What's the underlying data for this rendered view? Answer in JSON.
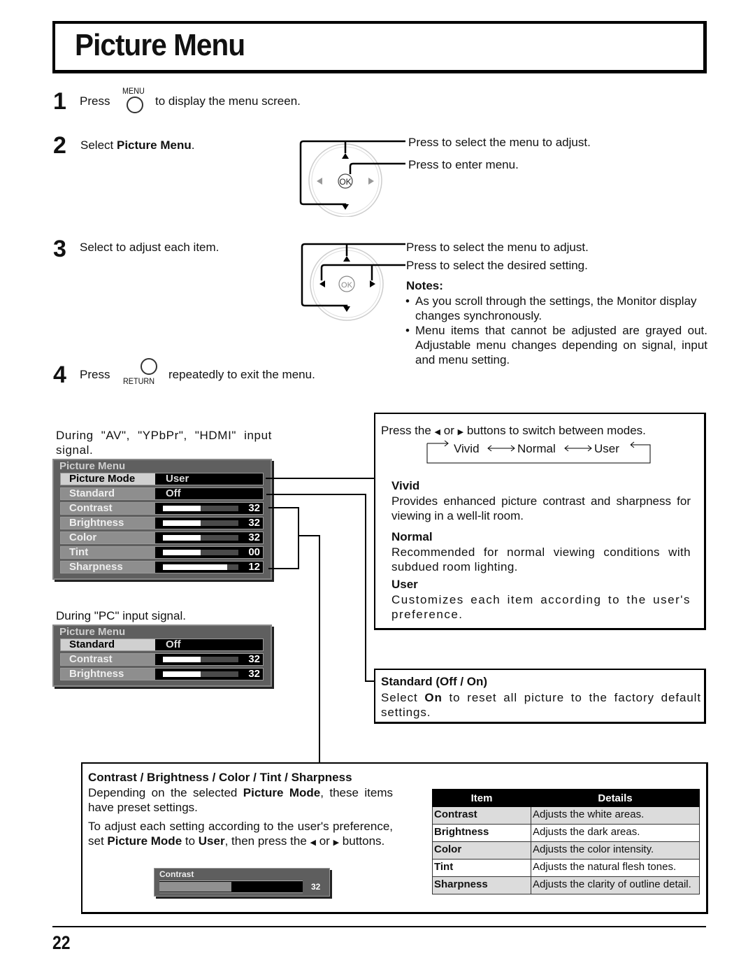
{
  "page": {
    "title": "Picture Menu",
    "page_number": "22"
  },
  "steps": [
    {
      "number": "1",
      "pre": "Press",
      "button_label": "MENU",
      "post": "to display the menu screen."
    },
    {
      "number": "2",
      "pre": "Select ",
      "bold": "Picture Menu",
      "post": "."
    },
    {
      "number": "3",
      "text": "Select to adjust each item."
    },
    {
      "number": "4",
      "pre": "Press",
      "button_label": "RETURN",
      "post": "repeatedly to exit the menu."
    }
  ],
  "remote_1": {
    "ok_label": "OK",
    "callouts": [
      "Press to select the menu to adjust.",
      "Press to enter menu."
    ]
  },
  "remote_2": {
    "ok_label": "OK",
    "callouts": [
      "Press to select the menu to adjust.",
      "Press to select the desired setting."
    ],
    "notes_heading": "Notes:",
    "notes": [
      "As you scroll through the settings, the Monitor display changes synchronously.",
      "Menu items that cannot be adjusted are grayed out. Adjustable menu changes depending on signal, input and menu setting."
    ]
  },
  "osd_av": {
    "caption": "During \"AV\", \"YPbPr\", \"HDMI\" input signal.",
    "title": "Picture Menu",
    "rows": [
      {
        "label": "Picture Mode",
        "value": "User",
        "selected": true
      },
      {
        "label": "Standard",
        "value": "Off"
      },
      {
        "label": "Contrast",
        "num": "32",
        "level": 0.5
      },
      {
        "label": "Brightness",
        "num": "32",
        "level": 0.5
      },
      {
        "label": "Color",
        "num": "32",
        "level": 0.5
      },
      {
        "label": "Tint",
        "num": "00",
        "level": 0.5
      },
      {
        "label": "Sharpness",
        "num": "12",
        "level": 0.85
      }
    ]
  },
  "osd_pc": {
    "caption": "During \"PC\" input signal.",
    "title": "Picture Menu",
    "rows": [
      {
        "label": "Standard",
        "value": "Off",
        "selected": true
      },
      {
        "label": "Contrast",
        "num": "32",
        "level": 0.5
      },
      {
        "label": "Brightness",
        "num": "32",
        "level": 0.5
      }
    ]
  },
  "modes_box": {
    "intro_pre": "Press the",
    "intro_mid": "or",
    "intro_post": "buttons to switch between modes.",
    "cycle": [
      "Vivid",
      "Normal",
      "User"
    ],
    "modes": [
      {
        "name": "Vivid",
        "desc": "Provides enhanced picture contrast and sharpness for viewing in a well-lit room."
      },
      {
        "name": "Normal",
        "desc": "Recommended for normal viewing conditions with subdued room lighting."
      },
      {
        "name": "User",
        "desc": "Customizes each item according to the user's preference."
      }
    ]
  },
  "standard_box": {
    "heading": "Standard (Off / On)",
    "pre": "Select ",
    "bold": "On",
    "post": " to reset all picture to the factory default settings."
  },
  "adjust_box": {
    "heading": "Contrast / Brightness / Color / Tint / Sharpness",
    "p1_pre": "Depending on the selected ",
    "p1_bold": "Picture Mode",
    "p1_post": ", these items have preset settings.",
    "p2_a": "To adjust each setting according to the user's preference, set ",
    "p2_b": "Picture Mode",
    "p2_c": " to ",
    "p2_d": "User",
    "p2_e": ", then press the",
    "p2_or": "or",
    "p2_f": "buttons.",
    "mini_osd": {
      "label": "Contrast",
      "num": "32",
      "level": 0.5
    },
    "table": {
      "headers": [
        "Item",
        "Details"
      ],
      "rows": [
        {
          "item": "Contrast",
          "details": "Adjusts the white areas."
        },
        {
          "item": "Brightness",
          "details": "Adjusts the dark areas."
        },
        {
          "item": "Color",
          "details": "Adjusts the color intensity."
        },
        {
          "item": "Tint",
          "details": "Adjusts the natural flesh tones."
        },
        {
          "item": "Sharpness",
          "details": "Adjusts the clarity of outline detail."
        }
      ]
    }
  }
}
